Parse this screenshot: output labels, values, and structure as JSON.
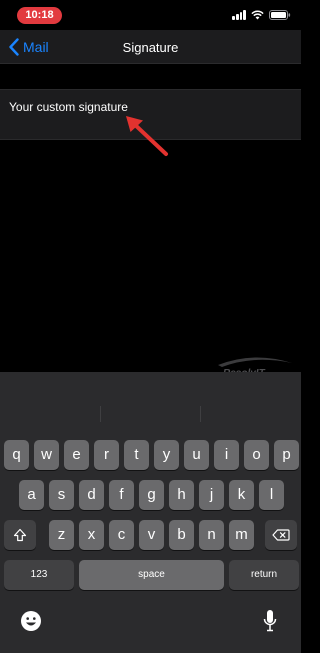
{
  "status": {
    "time": "10:18"
  },
  "nav": {
    "back_label": "Mail",
    "title": "Signature"
  },
  "signature": {
    "text": "Your custom signature"
  },
  "keyboard": {
    "row1": [
      "q",
      "w",
      "e",
      "r",
      "t",
      "y",
      "u",
      "i",
      "o",
      "p"
    ],
    "row2": [
      "a",
      "s",
      "d",
      "f",
      "g",
      "h",
      "j",
      "k",
      "l"
    ],
    "row3": [
      "z",
      "x",
      "c",
      "v",
      "b",
      "n",
      "m"
    ],
    "numbers_label": "123",
    "space_label": "space",
    "return_label": "return"
  },
  "colors": {
    "accent": "#1a84ff",
    "time_pill": "#e23a3f",
    "arrow": "#e2322f"
  },
  "watermark": {
    "text": "ResolvIT"
  }
}
